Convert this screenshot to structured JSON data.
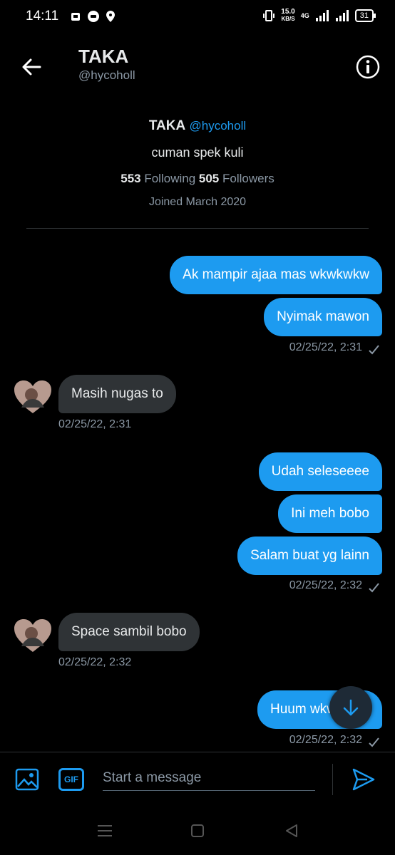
{
  "status_bar": {
    "time": "14:11",
    "speed_value": "15.0",
    "speed_unit": "KB/S",
    "network": "4G",
    "battery": "31"
  },
  "header": {
    "name": "TAKA",
    "handle": "@hycoholl"
  },
  "profile": {
    "name": "TAKA",
    "handle": "@hycoholl",
    "bio": "cuman spek kuli",
    "following_count": "553",
    "following_label": "Following",
    "followers_count": "505",
    "followers_label": "Followers",
    "joined": "Joined March 2020"
  },
  "messages": [
    {
      "from": "me",
      "text": "Ak mampir ajaa mas wkwkwkw"
    },
    {
      "from": "me",
      "text": "Nyimak mawon",
      "time": "02/25/22, 2:31"
    },
    {
      "from": "them",
      "text": "Masih nugas to",
      "time": "02/25/22, 2:31"
    },
    {
      "from": "me",
      "text": "Udah seleseeee"
    },
    {
      "from": "me",
      "text": "Ini meh bobo"
    },
    {
      "from": "me",
      "text": "Salam buat yg lainn",
      "time": "02/25/22, 2:32"
    },
    {
      "from": "them",
      "text": "Space sambil bobo",
      "time": "02/25/22, 2:32"
    },
    {
      "from": "me",
      "text": "Huum wkwkwk",
      "time": "02/25/22, 2:32"
    }
  ],
  "composer": {
    "placeholder": "Start a message",
    "gif_label": "GIF"
  },
  "colors": {
    "accent": "#1d9bf0",
    "received_bubble": "#2f3336",
    "background": "#000000"
  }
}
